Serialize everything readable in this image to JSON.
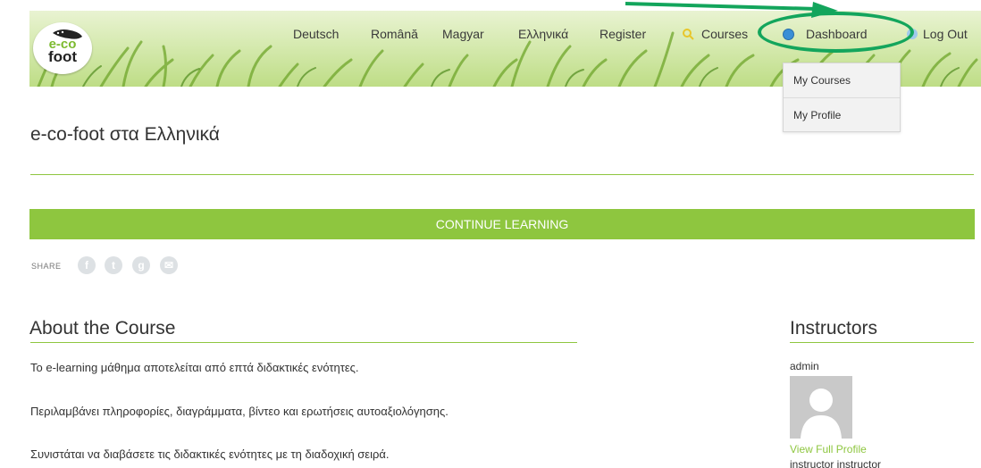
{
  "header": {
    "logo_text_eco": "e-co",
    "logo_text_foot": "foot",
    "nav": {
      "deutsch": "Deutsch",
      "romana": "Română",
      "magyar": "Magyar",
      "ellinika": "Ελληνικά",
      "register": "Register",
      "courses": "Courses",
      "dashboard": "Dashboard",
      "logout": "Log Out"
    },
    "icons": {
      "courses": "search-icon",
      "dashboard": "info-icon",
      "logout": "logout-icon"
    }
  },
  "dropdown": {
    "items": [
      "My Courses",
      "My Profile"
    ]
  },
  "course": {
    "title": "e-co-foot στα Ελληνικά",
    "continue_label": "CONTINUE LEARNING",
    "share_label": "SHARE",
    "share_icons": [
      "facebook-icon",
      "twitter-icon",
      "google-plus-icon",
      "email-icon"
    ]
  },
  "about": {
    "heading": "About the Course",
    "paragraphs": [
      "Το e-learning μάθημα αποτελείται από επτά διδακτικές ενότητες.",
      "Περιλαμβάνει πληροφορίες, διαγράμματα, βίντεο και ερωτήσεις αυτοαξιολόγησης.",
      "Συνιστάται να διαβάσετε τις διδακτικές ενότητες με τη διαδοχική σειρά."
    ]
  },
  "instructors": {
    "heading": "Instructors",
    "name": "admin",
    "view_profile": "View Full Profile",
    "next_name": "instructor instructor"
  },
  "colors": {
    "accent_green": "#8ec63f",
    "annotation_green": "#13a55c",
    "link_green": "#8ec63f"
  }
}
